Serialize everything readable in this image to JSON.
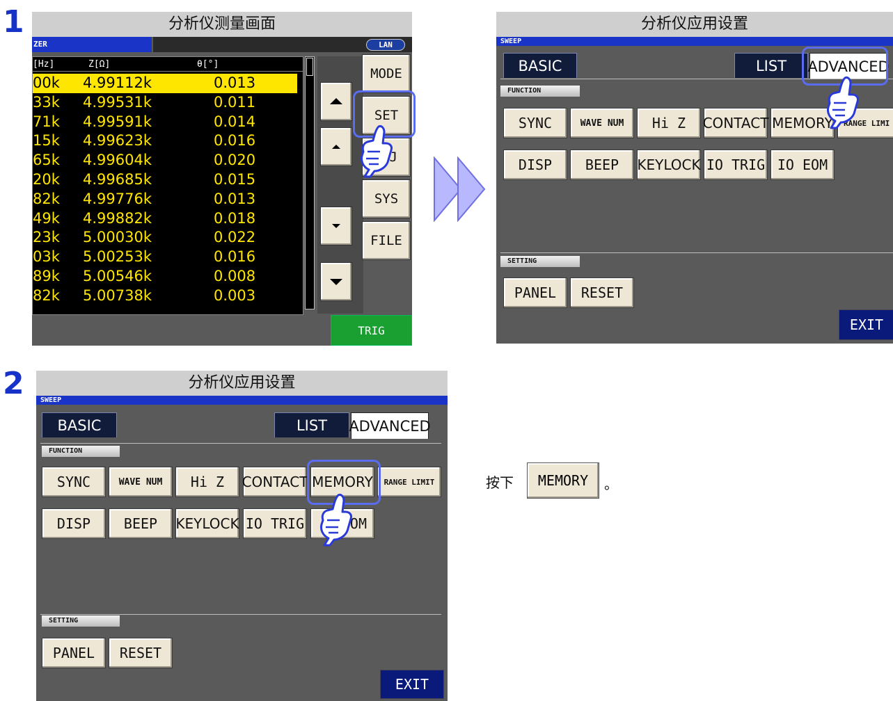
{
  "steps": [
    "1",
    "2"
  ],
  "measure_screen": {
    "title": "分析仪测量画面",
    "subbar": "ZER",
    "lan_badge": "LAN",
    "headers": [
      "[Hz]",
      "Z[Ω]",
      "θ[°]"
    ],
    "rows": [
      {
        "f": "00k",
        "z": "4.99112k",
        "t": "0.013"
      },
      {
        "f": "33k",
        "z": "4.99531k",
        "t": "0.011"
      },
      {
        "f": "71k",
        "z": "4.99591k",
        "t": "0.014"
      },
      {
        "f": "15k",
        "z": "4.99623k",
        "t": "0.016"
      },
      {
        "f": "65k",
        "z": "4.99604k",
        "t": "0.020"
      },
      {
        "f": "20k",
        "z": "4.99685k",
        "t": "0.015"
      },
      {
        "f": "82k",
        "z": "4.99776k",
        "t": "0.013"
      },
      {
        "f": "49k",
        "z": "4.99882k",
        "t": "0.018"
      },
      {
        "f": "23k",
        "z": "5.00030k",
        "t": "0.022"
      },
      {
        "f": "03k",
        "z": "5.00253k",
        "t": "0.016"
      },
      {
        "f": "89k",
        "z": "5.00546k",
        "t": "0.008"
      },
      {
        "f": "82k",
        "z": "5.00738k",
        "t": "0.003"
      }
    ],
    "side_buttons": [
      "MODE",
      "SET",
      "ADJ",
      "SYS",
      "FILE"
    ],
    "adj_partial": "J",
    "trig": "TRIG"
  },
  "settings_screen": {
    "title": "分析仪应用设置",
    "subbar": "SWEEP",
    "tab_basic": "BASIC",
    "tab_list": "LIST",
    "tab_advanced": "ADVANCED",
    "function_label": "FUNCTION",
    "function_row1": [
      "SYNC",
      "WAVE NUM",
      "Hi Z",
      "CONTACT",
      "MEMORY",
      "RANGE LIMIT"
    ],
    "function_row2": [
      "DISP",
      "BEEP",
      "KEYLOCK",
      "IO TRIG",
      "IO EOM"
    ],
    "setting_label": "SETTING",
    "setting_row": [
      "PANEL",
      "RESET"
    ],
    "exit": "EXIT",
    "range_limit_partial": "RANGE LIMI",
    "io_eom_partial": "OM"
  },
  "instruction": {
    "prefix": "按下",
    "button": "MEMORY",
    "suffix": "。"
  },
  "colors": {
    "accent_blue": "#1a34c8",
    "highlight": "#5a6cf0",
    "button_face": "#efe7d6",
    "trig_green": "#1aa030",
    "selected_row": "#ffe600"
  }
}
